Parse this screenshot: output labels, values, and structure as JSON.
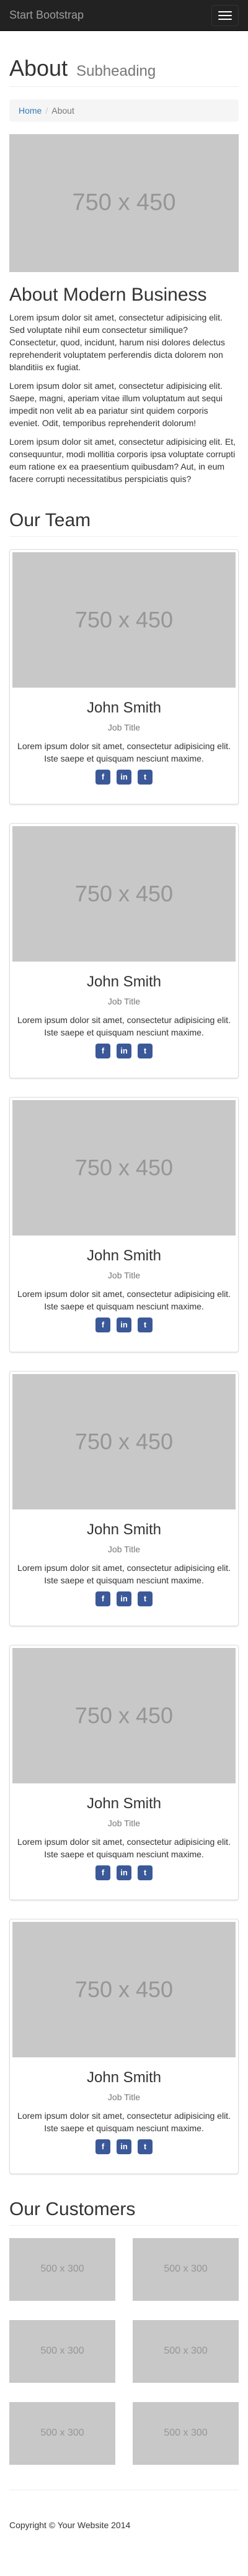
{
  "nav": {
    "brand": "Start Bootstrap"
  },
  "header": {
    "title": "About",
    "subtitle": "Subheading"
  },
  "breadcrumb": {
    "home": "Home",
    "current": "About"
  },
  "about": {
    "image_label": "750 x 450",
    "title": "About Modern Business",
    "paragraphs": [
      "Lorem ipsum dolor sit amet, consectetur adipisicing elit. Sed voluptate nihil eum consectetur similique? Consectetur, quod, incidunt, harum nisi dolores delectus reprehenderit voluptatem perferendis dicta dolorem non blanditiis ex fugiat.",
      "Lorem ipsum dolor sit amet, consectetur adipisicing elit. Saepe, magni, aperiam vitae illum voluptatum aut sequi impedit non velit ab ea pariatur sint quidem corporis eveniet. Odit, temporibus reprehenderit dolorum!",
      "Lorem ipsum dolor sit amet, consectetur adipisicing elit. Et, consequuntur, modi mollitia corporis ipsa voluptate corrupti eum ratione ex ea praesentium quibusdam? Aut, in eum facere corrupti necessitatibus perspiciatis quis?"
    ]
  },
  "team": {
    "heading": "Our Team",
    "members": [
      {
        "image": "750 x 450",
        "name": "John Smith",
        "role": "Job Title",
        "bio": "Lorem ipsum dolor sit amet, consectetur adipisicing elit. Iste saepe et quisquam nesciunt maxime."
      },
      {
        "image": "750 x 450",
        "name": "John Smith",
        "role": "Job Title",
        "bio": "Lorem ipsum dolor sit amet, consectetur adipisicing elit. Iste saepe et quisquam nesciunt maxime."
      },
      {
        "image": "750 x 450",
        "name": "John Smith",
        "role": "Job Title",
        "bio": "Lorem ipsum dolor sit amet, consectetur adipisicing elit. Iste saepe et quisquam nesciunt maxime."
      },
      {
        "image": "750 x 450",
        "name": "John Smith",
        "role": "Job Title",
        "bio": "Lorem ipsum dolor sit amet, consectetur adipisicing elit. Iste saepe et quisquam nesciunt maxime."
      },
      {
        "image": "750 x 450",
        "name": "John Smith",
        "role": "Job Title",
        "bio": "Lorem ipsum dolor sit amet, consectetur adipisicing elit. Iste saepe et quisquam nesciunt maxime."
      },
      {
        "image": "750 x 450",
        "name": "John Smith",
        "role": "Job Title",
        "bio": "Lorem ipsum dolor sit amet, consectetur adipisicing elit. Iste saepe et quisquam nesciunt maxime."
      }
    ],
    "social_icons": [
      "facebook-icon",
      "linkedin-icon",
      "twitter-icon"
    ]
  },
  "customers": {
    "heading": "Our Customers",
    "logos": [
      "500 x 300",
      "500 x 300",
      "500 x 300",
      "500 x 300",
      "500 x 300",
      "500 x 300"
    ]
  },
  "footer": {
    "copyright": "Copyright © Your Website 2014"
  },
  "colors": {
    "navbar": "#222222",
    "link": "#337ab7",
    "social": "#3b5998",
    "placeholder": "#c8c8c8"
  }
}
